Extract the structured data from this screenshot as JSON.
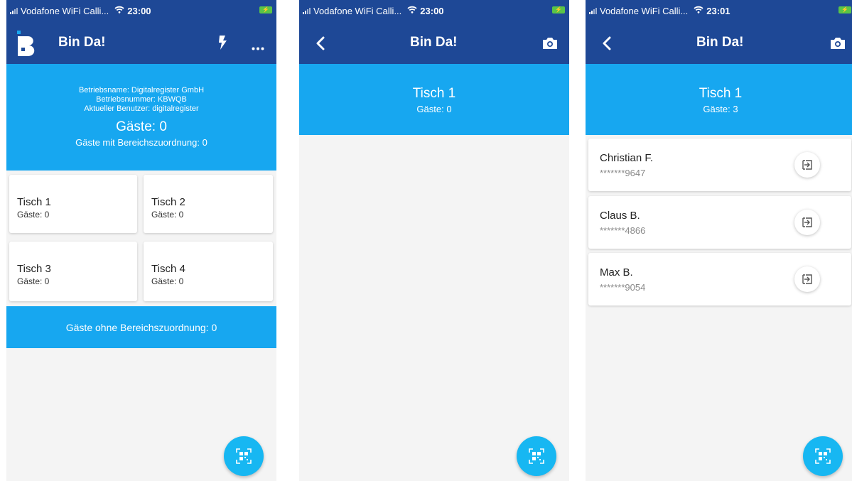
{
  "colors": {
    "appbar": "#1e4896",
    "accent": "#17a7f0",
    "fab": "#17b7f2",
    "background": "#f4f4f4"
  },
  "screens": [
    {
      "status": {
        "carrier": "Vodafone WiFi Calli...",
        "time": "23:00"
      },
      "app_title": "Bin Da!",
      "icons": [
        "logo-icon",
        "flash-icon",
        "more-icon"
      ],
      "info": {
        "betriebsname": "Betriebsname: Digitalregister GmbH",
        "betriebsnummer": "Betriebsnummer: KBWQB",
        "benutzer": "Aktueller Benutzer: digitalregister",
        "guests": "Gäste: 0",
        "guests_area": "Gäste mit Bereichszuordnung: 0"
      },
      "tables": [
        {
          "name": "Tisch 1",
          "guests": "Gäste: 0"
        },
        {
          "name": "Tisch 2",
          "guests": "Gäste: 0"
        },
        {
          "name": "Tisch 3",
          "guests": "Gäste: 0"
        },
        {
          "name": "Tisch 4",
          "guests": "Gäste: 0"
        }
      ],
      "unassigned": "Gäste ohne Bereichszuordnung: 0"
    },
    {
      "status": {
        "carrier": "Vodafone WiFi Calli...",
        "time": "23:00"
      },
      "app_title": "Bin Da!",
      "icons": [
        "back-icon",
        "camera-icon"
      ],
      "table": {
        "name": "Tisch 1",
        "guests": "Gäste: 0"
      }
    },
    {
      "status": {
        "carrier": "Vodafone WiFi Calli...",
        "time": "23:01"
      },
      "app_title": "Bin Da!",
      "icons": [
        "back-icon",
        "camera-icon",
        "checkout-icon"
      ],
      "table": {
        "name": "Tisch 1",
        "guests": "Gäste: 3"
      },
      "guest_list": [
        {
          "name": "Christian F.",
          "phone": "*******9647"
        },
        {
          "name": "Claus B.",
          "phone": "*******4866"
        },
        {
          "name": "Max B.",
          "phone": "*******9054"
        }
      ]
    }
  ]
}
